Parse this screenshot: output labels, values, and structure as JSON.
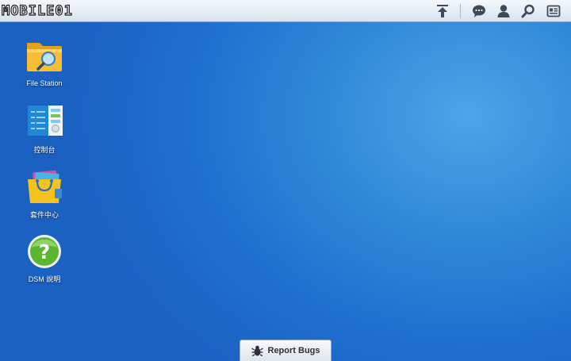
{
  "taskbar": {
    "logo_text": "MOBILE01",
    "icons": [
      "upload-icon",
      "chat-icon",
      "user-icon",
      "search-icon",
      "widgets-icon"
    ]
  },
  "desktop": {
    "icons": [
      {
        "label": "File Station",
        "icon": "file-station-icon"
      },
      {
        "label": "控制台",
        "icon": "control-panel-icon"
      },
      {
        "label": "套件中心",
        "icon": "package-center-icon"
      },
      {
        "label": "DSM 說明",
        "icon": "help-icon"
      }
    ]
  },
  "report_bugs": {
    "label": "Report Bugs",
    "icon": "bug-icon"
  },
  "colors": {
    "desktop": "#2a7fd6",
    "taskbar": "#e6edf4",
    "help_green": "#5cb531"
  }
}
